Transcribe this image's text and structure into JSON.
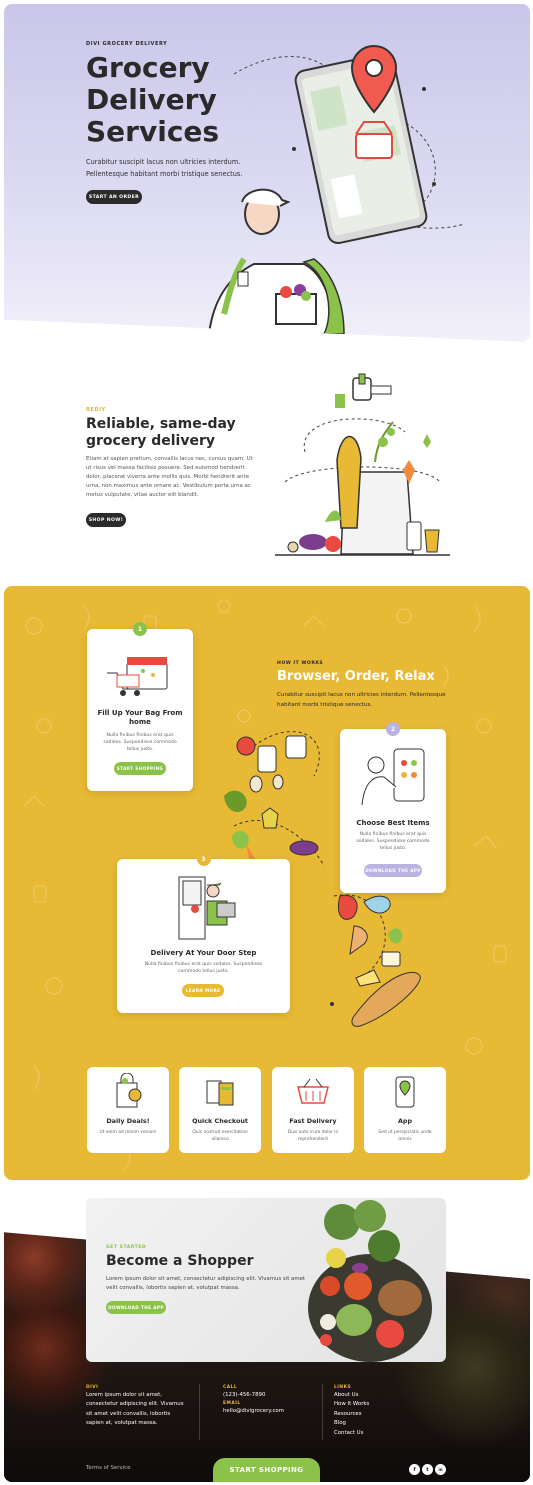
{
  "hero": {
    "eyebrow": "DIVI GROCERY DELIVERY",
    "title_lines": [
      "Grocery",
      "Delivery",
      "Services"
    ],
    "subtitle": "Curabitur suscipit lacus non ultricies interdum. Pellentesque habitant morbi tristique senectus.",
    "cta": "START AN ORDER"
  },
  "section2": {
    "eyebrow": "REDIY",
    "title": "Reliable, same-day grocery delivery",
    "body": "Etiam at sapien pretium, convallis lacus nec, cursus quam. Ut ut risus vel massa facilisis posuere. Sed euismod hendrerit dolor, placerat viverra ante mollis quis. Morbi hendrerit ante urna, non maximus ante ornare ac. Vestibulum porta urna ac metus vulputate, vitae auctor elit blandit.",
    "cta": "SHOP NOW!"
  },
  "how": {
    "eyebrow": "HOW IT WORKS",
    "title": "Browser, Order, Relax",
    "subtitle": "Curabitur suscipit lacus non ultricies interdum. Pellentesque habitant morbi tristique senectus.",
    "steps": [
      {
        "num": "1",
        "title": "Fill Up Your Bag From home",
        "text": "Nulla finibus finibus erat quis sodales. Suspendisse commodo tellus justo.",
        "cta": "START SHOPPING",
        "color": "#8bc34a"
      },
      {
        "num": "2",
        "title": "Choose Best Items",
        "text": "Nulla finibus finibus erat quis sodales. Suspendisse commodo tellus justo.",
        "cta": "DOWNLOAD THE APP",
        "color": "#b8b3e0"
      },
      {
        "num": "3",
        "title": "Delivery At Your Door Step",
        "text": "Nulla finibus finibus erat quis sodales. Suspendisse commodo tellus justo.",
        "cta": "LEARN MORE",
        "color": "#e8b935"
      }
    ]
  },
  "features": [
    {
      "title": "Daily Deals!",
      "text": "Ut enim ad minim veniam",
      "icon": "shopping-bag-icon"
    },
    {
      "title": "Quick Checkout",
      "text": "Quis nostrud exercitation ullamco",
      "icon": "cards-icon"
    },
    {
      "title": "Fast Delivery",
      "text": "Duis aute irure dolor in reprehenderit",
      "icon": "basket-icon"
    },
    {
      "title": "App",
      "text": "Sed ut perspiciatis unde omnis",
      "icon": "phone-icon"
    }
  ],
  "shopper": {
    "eyebrow": "GET STARTED",
    "title": "Become a Shopper",
    "text": "Lorem ipsum dolor sit amet, consectetur adipiscing elit. Vivamus sit amet velit convallis, lobortis sapien at, volutpat massa.",
    "cta": "DOWNLOAD THE APP"
  },
  "footer": {
    "col1_label": "DIVI",
    "col1_text": "Lorem ipsum dolor sit amet, consectetur adipiscing elit. Vivamus sit amet velit convallis, lobortis sapien at, volutpat massa.",
    "call_label": "CALL",
    "phone": "(123)-456-7890",
    "email_label": "EMAIL",
    "email": "hello@divigrocery.com",
    "links_label": "LINKS",
    "links": [
      "About Us",
      "How It Works",
      "Resources",
      "Blog",
      "Contact Us"
    ],
    "tos": "Terms of Service",
    "start": "START SHOPPING",
    "social": [
      "f",
      "t",
      "in"
    ]
  },
  "colors": {
    "green": "#8bc34a",
    "yellow": "#e8b935",
    "lavender": "#b8b3e0",
    "dark": "#2b2b2b"
  }
}
